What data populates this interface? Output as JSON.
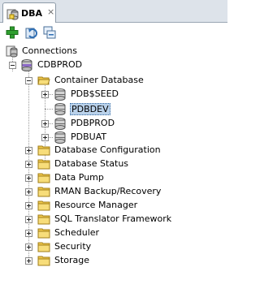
{
  "tab": {
    "title": "DBA",
    "close": "×"
  },
  "toolbar": {
    "buttons": [
      {
        "name": "add-connection-button",
        "icon": "plus-icon"
      },
      {
        "name": "refresh-button",
        "icon": "refresh-icon"
      },
      {
        "name": "collapse-all-button",
        "icon": "collapse-icon"
      }
    ]
  },
  "tree": {
    "root": "Connections",
    "connection": "CDBPROD",
    "container": "Container Database",
    "pdbs": [
      "PDB$SEED",
      "PDBDEV",
      "PDBPROD",
      "PDBUAT"
    ],
    "selected": "PDBDEV",
    "folders": [
      "Database Configuration",
      "Database Status",
      "Data Pump",
      "RMAN Backup/Recovery",
      "Resource Manager",
      "SQL Translator Framework",
      "Scheduler",
      "Security",
      "Storage"
    ]
  },
  "colors": {
    "folder": "#f2c94c",
    "selection": "#b9d1ea",
    "plus": "#2e9e2e"
  }
}
